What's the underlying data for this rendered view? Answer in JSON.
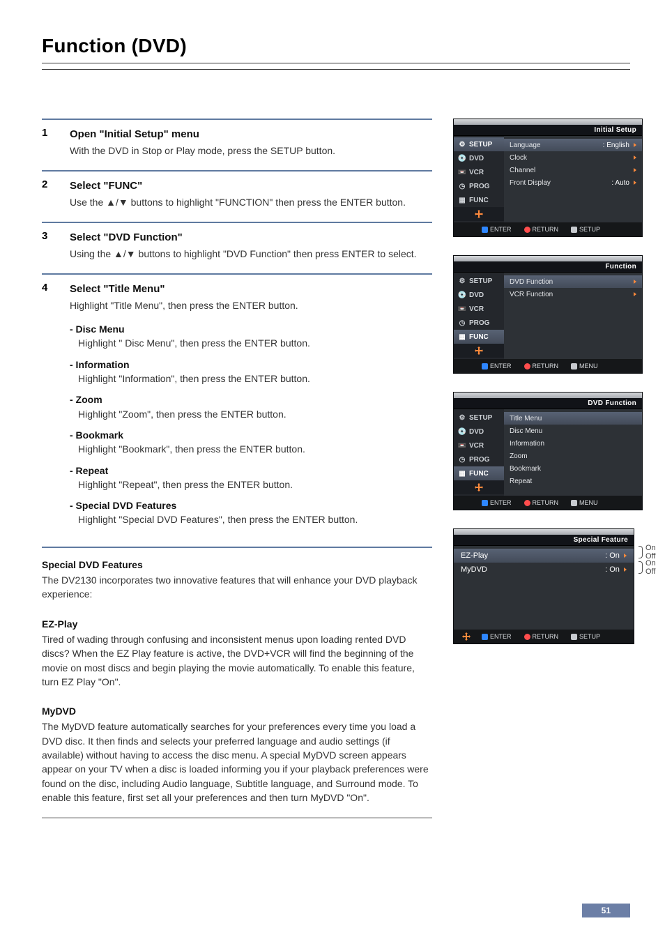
{
  "page": {
    "title": "Function (DVD)",
    "page_number": "51"
  },
  "steps": [
    {
      "num": "1",
      "heading": "Open \"Initial Setup\" menu",
      "text": "With the DVD in Stop or Play mode, press the SETUP button."
    },
    {
      "num": "2",
      "heading": "Select \"FUNC\"",
      "text": "Use the ▲/▼ buttons to highlight \"FUNCTION\" then press the ENTER button."
    },
    {
      "num": "3",
      "heading": "Select \"DVD Function\"",
      "text": "Using the ▲/▼ buttons to highlight \"DVD Function\"  then press ENTER to select."
    },
    {
      "num": "4",
      "heading": "Select \"Title Menu\"",
      "text": "Highlight \"Title Menu\", then press the ENTER button.",
      "subitems": [
        {
          "h": "- Disc Menu",
          "d": "Highlight \" Disc Menu\", then press the ENTER button."
        },
        {
          "h": "- Information",
          "d": "Highlight \"Information\", then press the ENTER button."
        },
        {
          "h": "- Zoom",
          "d": "Highlight \"Zoom\", then press the ENTER button."
        },
        {
          "h": "- Bookmark",
          "d": "Highlight \"Bookmark\", then press the ENTER button."
        },
        {
          "h": "- Repeat",
          "d": "Highlight \"Repeat\", then press the ENTER button."
        },
        {
          "h": "- Special DVD Features",
          "d": "Highlight \"Special DVD Features\", then press the ENTER button."
        }
      ]
    }
  ],
  "sections": {
    "special": {
      "h": "Special DVD Features",
      "p": "The DV2130 incorporates two innovative features that will enhance your DVD playback experience:"
    },
    "ezplay": {
      "h": "EZ-Play",
      "p": "Tired of wading through confusing and inconsistent menus upon loading rented DVD discs? When the EZ Play feature is active, the DVD+VCR will find the beginning of the movie on most discs and begin playing the movie automatically. To enable this feature, turn EZ Play \"On\"."
    },
    "mydvd": {
      "h": "MyDVD",
      "p": "The MyDVD feature automatically searches for your preferences every time you load a DVD disc. It then finds and selects your preferred language and audio settings (if available) without having to access the disc menu. A special MyDVD screen appears appear on your TV when a disc is loaded informing you if your playback preferences were found on the disc, including Audio language, Subtitle language, and Surround mode. To enable this feature, first set all your preferences and then turn MyDVD \"On\"."
    }
  },
  "osd_tabs": {
    "setup": "SETUP",
    "dvd": "DVD",
    "vcr": "VCR",
    "prog": "PROG",
    "func": "FUNC"
  },
  "osd_footer": {
    "enter": "ENTER",
    "return": "RETURN",
    "setup": "SETUP",
    "menu": "MENU"
  },
  "osd1": {
    "title": "Initial Setup",
    "rows": [
      {
        "l": "Language",
        "r": ": English",
        "sel": true
      },
      {
        "l": "Clock",
        "r": ""
      },
      {
        "l": "Channel",
        "r": ""
      },
      {
        "l": "Front Display",
        "r": ": Auto"
      }
    ]
  },
  "osd2": {
    "title": "Function",
    "rows": [
      {
        "l": "DVD Function",
        "sel": true
      },
      {
        "l": "VCR Function"
      }
    ]
  },
  "osd3": {
    "title": "DVD Function",
    "rows": [
      {
        "l": "Title Menu",
        "sel": true
      },
      {
        "l": "Disc Menu"
      },
      {
        "l": "Information"
      },
      {
        "l": "Zoom"
      },
      {
        "l": "Bookmark"
      },
      {
        "l": "Repeat"
      }
    ]
  },
  "osd4": {
    "title": "Special Feature",
    "rows": [
      {
        "l": "EZ-Play",
        "r": ": On",
        "sel": true
      },
      {
        "l": "MyDVD",
        "r": ": On"
      }
    ],
    "options_a": [
      "On",
      "Off"
    ],
    "options_b": [
      "On",
      "Off"
    ]
  }
}
